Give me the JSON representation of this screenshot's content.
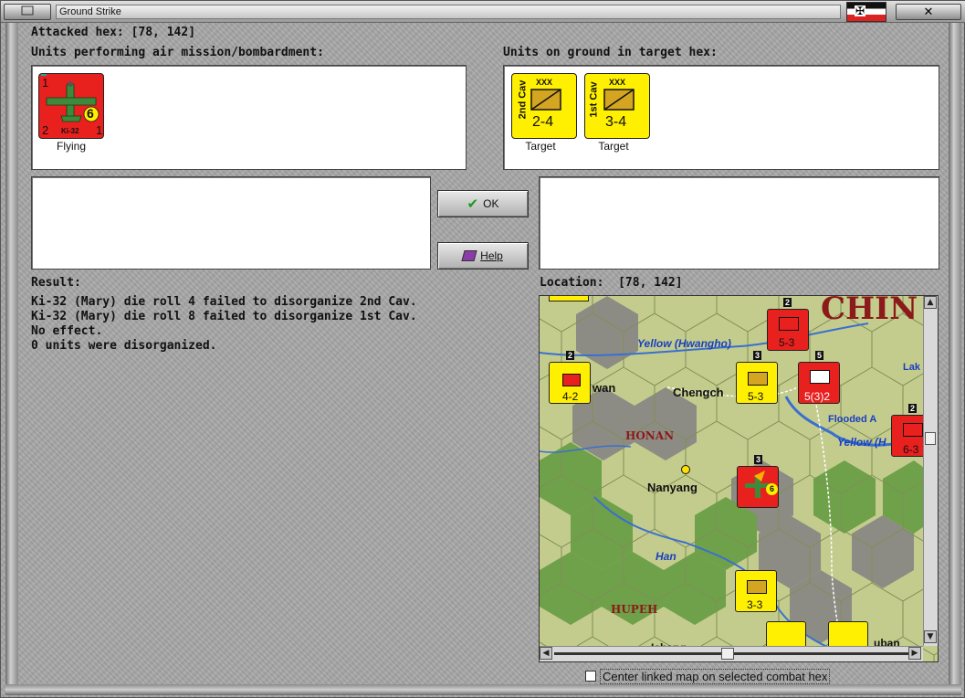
{
  "window": {
    "title": "Ground Strike"
  },
  "header": {
    "attacked_hex_label": "Attacked hex:",
    "attacked_hex_value": "[78, 142]"
  },
  "air_units": {
    "label": "Units performing air mission/bombardment:",
    "units": [
      {
        "name": "Ki-32",
        "attack": "6",
        "top_left": "1",
        "bottom_left": "2",
        "bottom_right": "1",
        "status": "Flying"
      }
    ]
  },
  "ground_units": {
    "label": "Units on ground in target hex:",
    "units": [
      {
        "side_label": "2nd Cav",
        "size": "XXX",
        "strength": "2-4",
        "status": "Target"
      },
      {
        "side_label": "1st Cav",
        "size": "XXX",
        "strength": "3-4",
        "status": "Target"
      }
    ]
  },
  "buttons": {
    "ok": "OK",
    "help": "Help"
  },
  "result": {
    "label": "Result:",
    "lines": [
      "Ki-32 (Mary) die roll 4 failed to disorganize 2nd Cav.",
      "Ki-32 (Mary) die roll 8 failed to disorganize 1st Cav.",
      "No effect.",
      "0 units were disorganized."
    ]
  },
  "location": {
    "label": "Location:",
    "value": "[78, 142]"
  },
  "map": {
    "labels": {
      "country": "CHIN",
      "river1": "Yellow (Hwangho)",
      "river2": "Yellow (H",
      "river3": "Han",
      "city1": "Chengch",
      "city2": "Nanyang",
      "city3": "wan",
      "region1": "HONAN",
      "region2": "HUPEH",
      "flooded": "Flooded A",
      "lake": "Lak",
      "bottom1": "Ichang",
      "bottom2": "uban"
    },
    "units": [
      {
        "strength": "5-3",
        "color": "red",
        "stack": "2"
      },
      {
        "strength": "4-2",
        "color": "yellow",
        "stack": "2"
      },
      {
        "strength": "5-3",
        "color": "yellow",
        "stack": "3"
      },
      {
        "strength": "5(3)2",
        "color": "red",
        "stack": "5"
      },
      {
        "strength": "6-3",
        "color": "red",
        "stack": "2"
      },
      {
        "strength": "3-3",
        "color": "yellow",
        "stack": ""
      },
      {
        "strength": "6",
        "color": "red",
        "stack": "3"
      }
    ]
  },
  "footer": {
    "center_checkbox_label": "Center linked map on selected combat hex"
  },
  "colors": {
    "allied_counter": "#ffef00",
    "axis_counter": "#e8201e"
  }
}
